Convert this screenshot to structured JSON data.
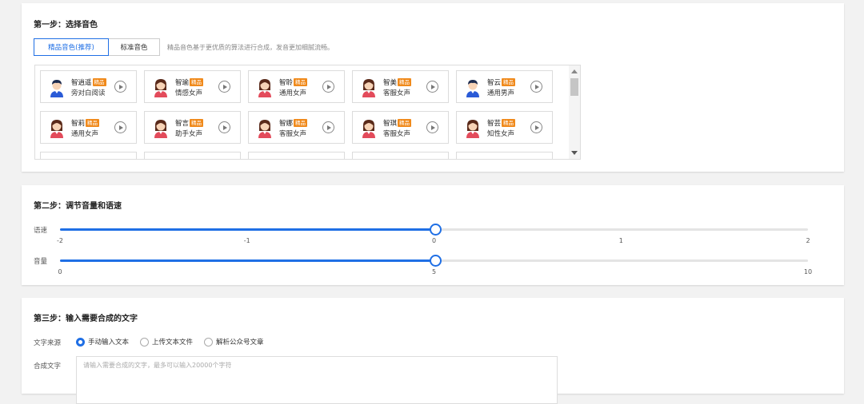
{
  "step1": {
    "title": "第一步：选择音色",
    "tabs": [
      {
        "label": "精品音色(推荐)",
        "active": true
      },
      {
        "label": "标准音色",
        "active": false
      }
    ],
    "tab_description": "精品音色基于更优质的算法进行合成，发音更加细腻流畅。",
    "badge_label": "精品",
    "voices": [
      {
        "name": "智逍遥",
        "desc": "旁对白阅读",
        "gender": "male"
      },
      {
        "name": "智瑜",
        "desc": "情感女声",
        "gender": "female"
      },
      {
        "name": "智聆",
        "desc": "通用女声",
        "gender": "female"
      },
      {
        "name": "智美",
        "desc": "客服女声",
        "gender": "female"
      },
      {
        "name": "智云",
        "desc": "通用男声",
        "gender": "male"
      },
      {
        "name": "智莉",
        "desc": "通用女声",
        "gender": "female"
      },
      {
        "name": "智言",
        "desc": "助手女声",
        "gender": "female"
      },
      {
        "name": "智娜",
        "desc": "客服女声",
        "gender": "female"
      },
      {
        "name": "智琪",
        "desc": "客服女声",
        "gender": "female"
      },
      {
        "name": "智芸",
        "desc": "知性女声",
        "gender": "female"
      }
    ]
  },
  "step2": {
    "title": "第二步：调节音量和语速",
    "sliders": [
      {
        "label": "语速",
        "min": -2,
        "max": 2,
        "value": 0,
        "ticks": [
          "-2",
          "-1",
          "0",
          "1",
          "2"
        ]
      },
      {
        "label": "音量",
        "min": 0,
        "max": 10,
        "value": 5,
        "ticks": [
          "0",
          "5",
          "10"
        ]
      }
    ]
  },
  "step3": {
    "title": "第三步：输入需要合成的文字",
    "source_label": "文字来源",
    "sources": [
      {
        "label": "手动输入文本",
        "checked": true
      },
      {
        "label": "上传文本文件",
        "checked": false
      },
      {
        "label": "解析公众号文章",
        "checked": false
      }
    ],
    "text_label": "合成文字",
    "text_placeholder": "请输入需要合成的文字，最多可以输入20000个字符",
    "text_value": ""
  },
  "colors": {
    "accent": "#1f6fe5",
    "badge": "#f08a1c"
  }
}
